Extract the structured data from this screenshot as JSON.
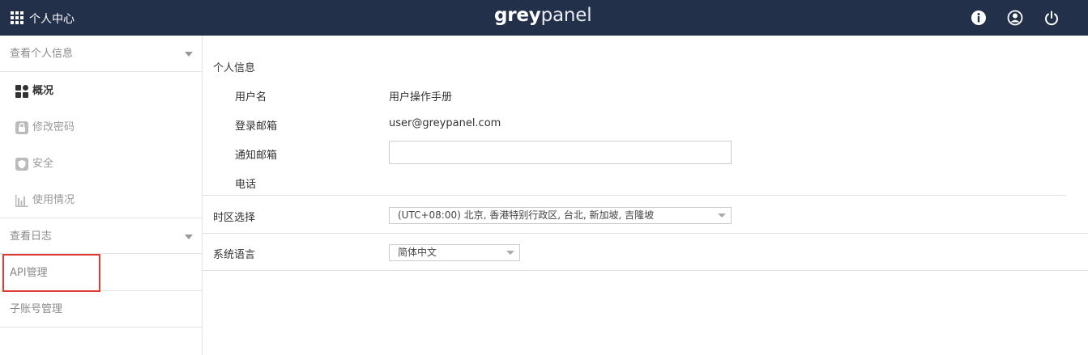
{
  "header": {
    "home_title": "个人中心",
    "logo_bold": "grey",
    "logo_thin": "panel"
  },
  "sidebar": {
    "profile_section": "查看个人信息",
    "items": [
      {
        "label": "概况",
        "icon": "dashboard-grid-icon",
        "active": true
      },
      {
        "label": "修改密码",
        "icon": "lock-icon",
        "active": false
      },
      {
        "label": "安全",
        "icon": "shield-icon",
        "active": false
      },
      {
        "label": "使用情况",
        "icon": "bar-chart-icon",
        "active": false
      }
    ],
    "logs_section": "查看日志",
    "api_section": "API管理",
    "subaccount_section": "子账号管理",
    "highlight_color": "#e03b32"
  },
  "main": {
    "personal_info_title": "个人信息",
    "username_label": "用户名",
    "username_value": "用户操作手册",
    "login_email_label": "登录邮箱",
    "login_email_value": "user@greypanel.com",
    "notify_email_label": "通知邮箱",
    "notify_email_value": "",
    "phone_label": "电话",
    "timezone_label": "时区选择",
    "timezone_value": "(UTC+08:00) 北京, 香港特别行政区, 台北, 新加坡, 吉隆坡",
    "language_label": "系统语言",
    "language_value": "简体中文"
  },
  "colors": {
    "header_bg": "#23304a",
    "highlight": "#e03b32"
  }
}
